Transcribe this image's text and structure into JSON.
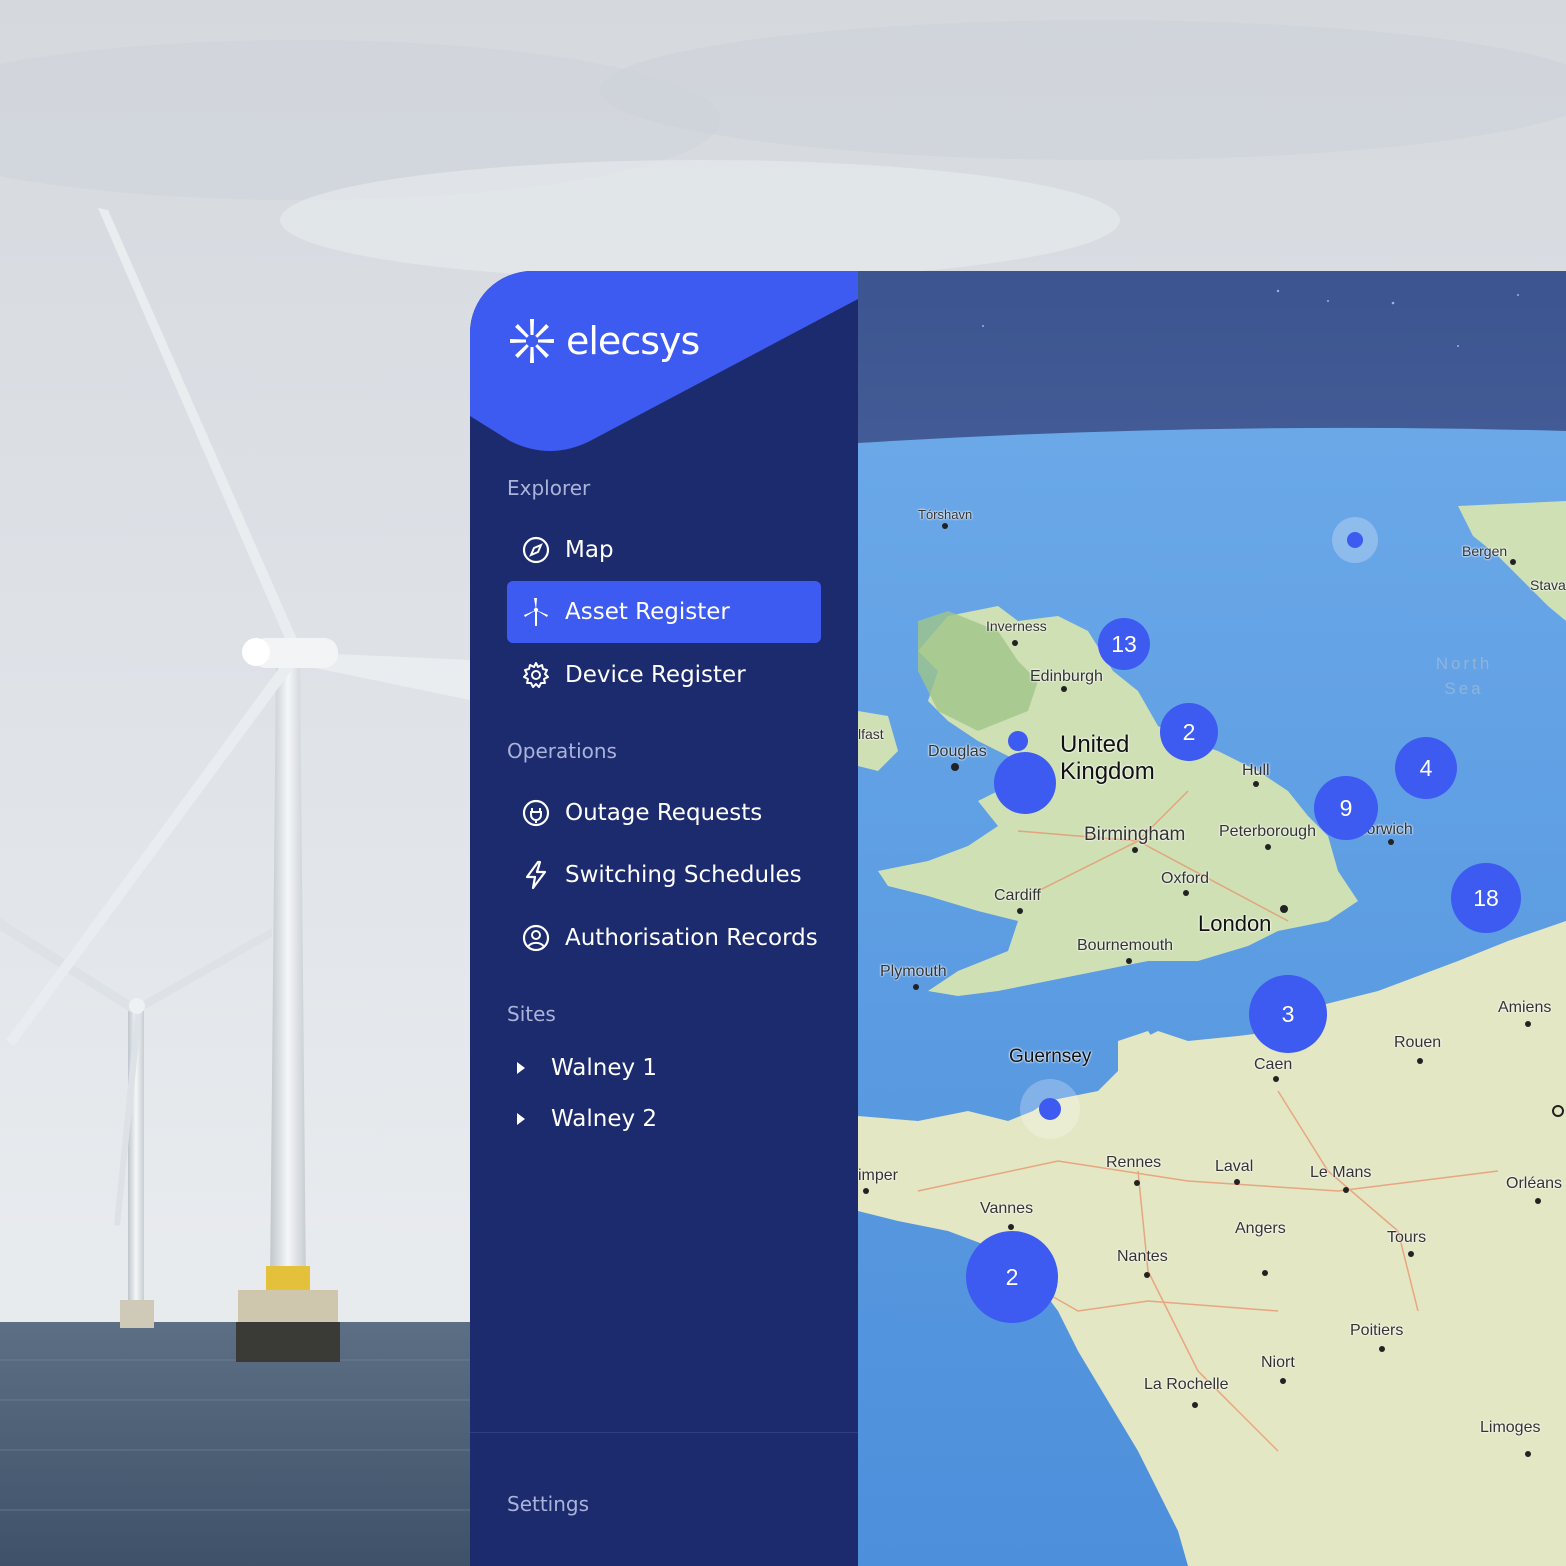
{
  "brand": {
    "name": "elecsys",
    "accent": "#3d5af1",
    "sidebar_bg": "#1c2a6e"
  },
  "sidebar": {
    "sections": [
      {
        "label": "Explorer",
        "items": [
          {
            "label": "Map",
            "icon": "compass-icon",
            "active": false
          },
          {
            "label": "Asset Register",
            "icon": "wind-turbine-icon",
            "active": true
          },
          {
            "label": "Device Register",
            "icon": "gear-icon",
            "active": false
          }
        ]
      },
      {
        "label": "Operations",
        "items": [
          {
            "label": "Outage Requests",
            "icon": "plug-icon",
            "active": false
          },
          {
            "label": "Switching Schedules",
            "icon": "lightning-icon",
            "active": false
          },
          {
            "label": "Authorisation Records",
            "icon": "user-circle-icon",
            "active": false
          }
        ]
      },
      {
        "label": "Sites",
        "items": [
          {
            "label": "Walney 1",
            "icon": "caret-right-icon"
          },
          {
            "label": "Walney 2",
            "icon": "caret-right-icon"
          }
        ]
      }
    ],
    "settings_label": "Settings"
  },
  "map": {
    "clusters": [
      "13",
      "2",
      "4",
      "9",
      "18",
      "3",
      "2"
    ],
    "places": {
      "torshavn": "Tórshavn",
      "bergen": "Bergen",
      "stavanger": "Stava",
      "inverness": "Inverness",
      "north_sea": "North Sea",
      "edinburgh": "Edinburgh",
      "belfast": "lfast",
      "douglas": "Douglas",
      "united_kingdom": "United Kingdom",
      "hull": "Hull",
      "birmingham": "Birmingham",
      "peterborough": "Peterborough",
      "norwich": "Norwich",
      "oxford": "Oxford",
      "cardiff": "Cardiff",
      "london": "London",
      "bournemouth": "Bournemouth",
      "plymouth": "Plymouth",
      "amiens": "Amiens",
      "rouen": "Rouen",
      "guernsey": "Guernsey",
      "caen": "Caen",
      "rennes": "Rennes",
      "laval": "Laval",
      "le_mans": "Le Mans",
      "quimper": "imper",
      "orleans": "Orléans",
      "vannes": "Vannes",
      "angers": "Angers",
      "tours": "Tours",
      "nantes": "Nantes",
      "poitiers": "Poitiers",
      "niort": "Niort",
      "la_rochelle": "La Rochelle",
      "limoges": "Limoges"
    }
  }
}
